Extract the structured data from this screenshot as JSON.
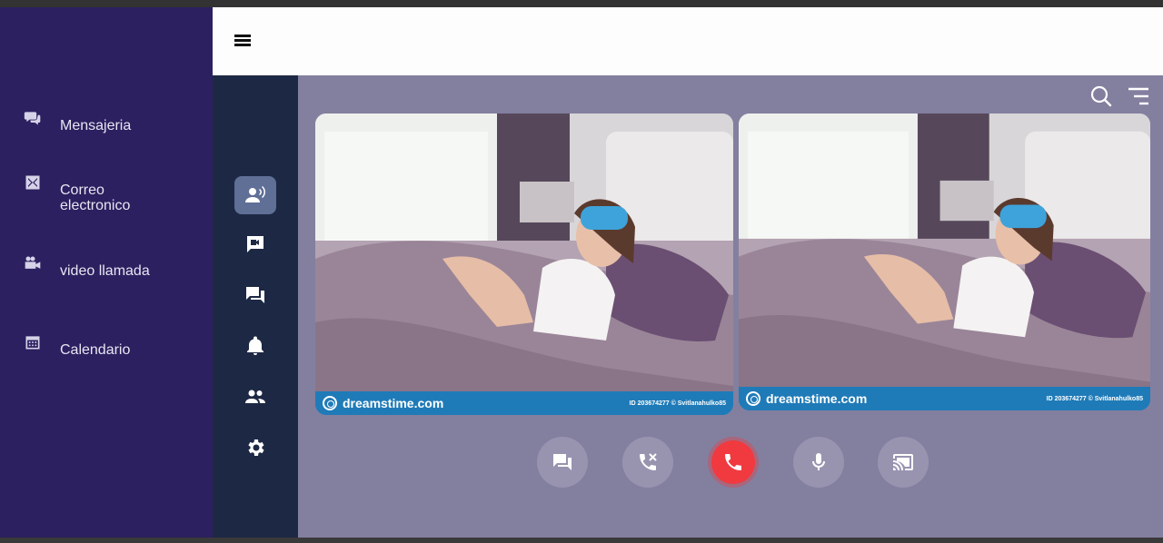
{
  "sidebar": {
    "items": [
      {
        "label": "Mensajeria",
        "icon": "chat-bubbles-icon"
      },
      {
        "label": "Correo electronico",
        "icon": "mail-icon"
      },
      {
        "label": "video llamada",
        "icon": "video-camera-icon"
      },
      {
        "label": "Calendario",
        "icon": "calendar-icon"
      }
    ]
  },
  "header": {
    "menu_icon": "hamburger-icon"
  },
  "rail": {
    "items": [
      {
        "icon": "contact-voice-icon",
        "active": true
      },
      {
        "icon": "video-chat-icon",
        "active": false
      },
      {
        "icon": "forum-icon",
        "active": false
      },
      {
        "icon": "bell-icon",
        "active": false
      },
      {
        "icon": "people-icon",
        "active": false
      },
      {
        "icon": "settings-icon",
        "active": false
      }
    ]
  },
  "toolbar": {
    "search_icon": "search-icon",
    "menu_icon": "sort-menu-icon"
  },
  "videos": [
    {
      "brand": "dreamstime.com",
      "id_text": "ID 203674277 © Svitlanahulko85"
    },
    {
      "brand": "dreamstime.com",
      "id_text": "ID 203674277 © Svitlanahulko85"
    }
  ],
  "controls": [
    {
      "icon": "chat-icon"
    },
    {
      "icon": "call-disabled-icon"
    },
    {
      "icon": "end-call-icon"
    },
    {
      "icon": "microphone-icon"
    },
    {
      "icon": "cast-screen-icon"
    }
  ],
  "colors": {
    "sidebar_bg": "#2c2060",
    "rail_bg": "#1d2944",
    "main_bg": "#837f9f",
    "end_call": "#f03a3f",
    "credit_bar": "#1f7bb8"
  }
}
